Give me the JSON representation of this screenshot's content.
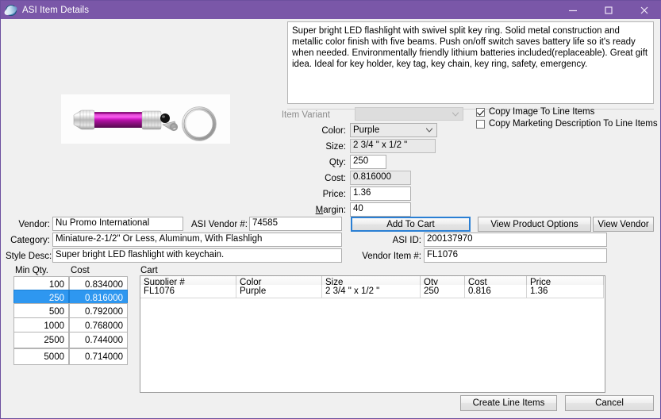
{
  "window": {
    "title": "ASI Item Details",
    "icon": "asi-globe-icon",
    "minimize_label": "Minimize",
    "maximize_label": "Maximize",
    "close_label": "Close",
    "accent_color": "#7a57a8"
  },
  "product": {
    "image_alt": "purple-led-keychain-flashlight",
    "description": "Super bright LED flashlight with swivel split key ring. Solid metal construction and metallic color finish with five beams. Push on/off switch saves battery life so it's ready when needed. Environmentally friendly lithium batteries included(replaceable).  Great gift idea. Ideal for key holder, key tag, key chain, key ring, safety, emergency."
  },
  "details": {
    "item_variant_label": "Item Variant",
    "item_variant_value": "",
    "color_label": "Color:",
    "color_value": "Purple",
    "size_label": "Size:",
    "size_value": "2 3/4 \" x 1/2 \"",
    "qty_label": "Qty:",
    "qty_value": "250",
    "cost_label": "Cost:",
    "cost_value": "0.816000",
    "price_label": "Price:",
    "price_value": "1.36",
    "margin_label_accel": "M",
    "margin_label_rest": "argin:",
    "margin_value": "40"
  },
  "checkboxes": [
    {
      "label": "Copy Image To Line Items",
      "checked": true,
      "name": "copy-image-to-line-items"
    },
    {
      "label": "Copy Marketing Description To Line Items",
      "checked": false,
      "name": "copy-marketing-description-to-line-items"
    }
  ],
  "vendor_section": {
    "vendor_label": "Vendor:",
    "vendor_value": "Nu Promo International",
    "asi_vendor_label": "ASI Vendor #:",
    "asi_vendor_value": "74585",
    "category_label": "Category:",
    "category_value": "Miniature-2-1/2\" Or Less, Aluminum, With Flashligh",
    "style_desc_label": "Style Desc:",
    "style_desc_value": "Super bright LED flashlight with keychain.",
    "asi_id_label": "ASI ID:",
    "asi_id_value": "200137970",
    "vendor_item_label": "Vendor Item #:",
    "vendor_item_value": "FL1076"
  },
  "actions": {
    "add_to_cart": "Add To Cart",
    "view_product_options": "View Product Options",
    "view_vendor": "View Vendor",
    "create_line_items": "Create Line Items",
    "cancel": "Cancel"
  },
  "pricing_grid": {
    "headers": [
      "Min Qty.",
      "Cost"
    ],
    "rows": [
      {
        "min_qty": "100",
        "cost": "0.834000",
        "selected": false
      },
      {
        "min_qty": "250",
        "cost": "0.816000",
        "selected": true
      },
      {
        "min_qty": "500",
        "cost": "0.792000",
        "selected": false
      },
      {
        "min_qty": "1000",
        "cost": "0.768000",
        "selected": false
      },
      {
        "min_qty": "2500",
        "cost": "0.744000",
        "selected": false
      },
      {
        "min_qty": "5000",
        "cost": "0.714000",
        "selected": false
      }
    ]
  },
  "cart": {
    "title": "Cart",
    "columns": [
      "Supplier #",
      "Color",
      "Size",
      "Qty",
      "Cost",
      "Price"
    ],
    "rows": [
      {
        "supplier": "FL1076",
        "color": "Purple",
        "size": "2 3/4 \" x 1/2 \"",
        "qty": "250",
        "cost": "0.816",
        "price": "1.36"
      }
    ]
  }
}
